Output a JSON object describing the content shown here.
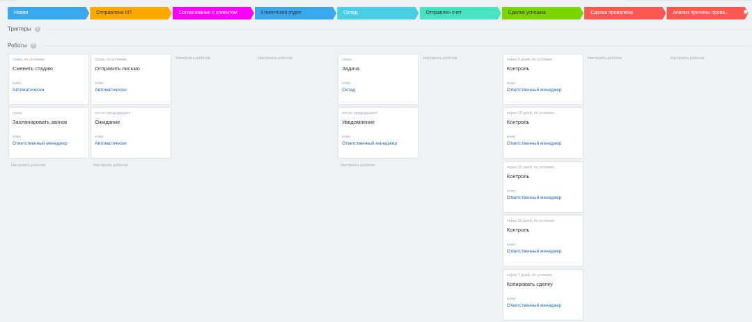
{
  "stages": [
    {
      "label": "Новая",
      "bg": "#39a8ef",
      "color": "#ffffff"
    },
    {
      "label": "Отправлено КП",
      "bg": "#ffa900",
      "color": "#333333"
    },
    {
      "label": "Согласование с клиентом",
      "bg": "#ff00ff",
      "color": "#ffffff"
    },
    {
      "label": "Клиентский отдел",
      "bg": "#3aa8ef",
      "color": "#333333"
    },
    {
      "label": "Склад",
      "bg": "#47d0e4",
      "color": "#ffffff"
    },
    {
      "label": "Отправлен счет",
      "bg": "#47e4c2",
      "color": "#333333"
    },
    {
      "label": "Сделка успешна",
      "bg": "#7bd500",
      "color": "#333333"
    },
    {
      "label": "Сделка провалена",
      "bg": "#ff5752",
      "color": "#ffffff"
    },
    {
      "label": "Анализ причины прова...",
      "bg": "#ff5752",
      "color": "#ffffff"
    }
  ],
  "triggers": {
    "title": "Триггеры",
    "help": "?"
  },
  "robots": {
    "title": "Роботы",
    "help": "?"
  },
  "columns": [
    {
      "cards": [
        {
          "cond": "сразу, по условию",
          "title": "Сменить стадию",
          "to": "кому:",
          "resp": "Автоматически"
        },
        {
          "cond": "сразу",
          "title": "Запланировать звонок",
          "to": "кому:",
          "resp": "Ответственный менеджер"
        }
      ],
      "setup": "Настроить роботов"
    },
    {
      "cards": [
        {
          "cond": "сразу, по условию",
          "title": "Отправить письмо",
          "to": "кому:",
          "resp": "Автоматически"
        },
        {
          "cond": "после предыдущего",
          "title": "Ожидание",
          "to": "кому:",
          "resp": "Автоматически"
        }
      ],
      "setup": "Настроить роботов"
    },
    {
      "cards": [],
      "setup": "Настроить роботов"
    },
    {
      "cards": [],
      "setup": "Настроить роботов"
    },
    {
      "cards": [
        {
          "cond": "сразу",
          "title": "Задача",
          "to": "кому:",
          "resp": "Склад"
        },
        {
          "cond": "после предыдущего",
          "title": "Уведомление",
          "to": "кому:",
          "resp": "Ответственный менеджер"
        }
      ],
      "setup": "Настроить роботов"
    },
    {
      "cards": [],
      "setup": "Настроить роботов"
    },
    {
      "cards": [
        {
          "cond": "через 5 дней, по условию",
          "title": "Контроль",
          "to": "кому:",
          "resp": "Ответственный менеджер"
        },
        {
          "cond": "через 10 дней, по условию",
          "title": "Контроль",
          "to": "кому:",
          "resp": "Ответственный менеджер"
        },
        {
          "cond": "через 15 дней, по условию",
          "title": "Контроль",
          "to": "кому:",
          "resp": "Ответственный менеджер"
        },
        {
          "cond": "через 20 дней, по условию",
          "title": "Контроль",
          "to": "кому:",
          "resp": "Ответственный менеджер"
        },
        {
          "cond": "через 7 дней, по условию",
          "title": "Копировать сделку",
          "to": "кому:",
          "resp": "Ответственный менеджер"
        }
      ],
      "setup": ""
    },
    {
      "cards": [],
      "setup": "Настроить роботов"
    },
    {
      "cards": [],
      "setup": "Настроить роботов"
    }
  ]
}
